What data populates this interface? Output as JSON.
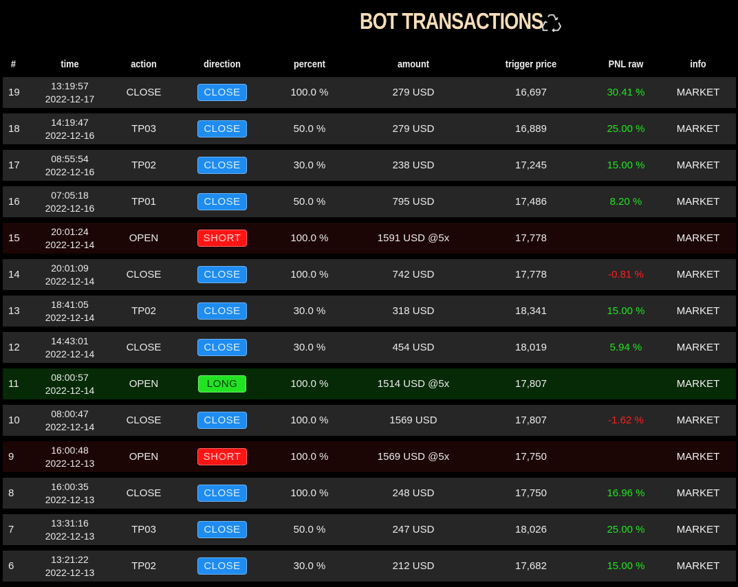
{
  "header": {
    "title": "BOT TRANSACTIONS",
    "refresh_icon": "recycle-icon"
  },
  "columns": [
    "#",
    "time",
    "action",
    "direction",
    "percent",
    "amount",
    "trigger price",
    "PNL raw",
    "info"
  ],
  "colors": {
    "close_badge": "#1e8cf0",
    "short_badge": "#ff1414",
    "long_badge": "#22e322",
    "pnl_positive": "#1ee61e",
    "pnl_negative": "#ff1f1f",
    "title": "#f5ddb8"
  },
  "rows": [
    {
      "num": "19",
      "time": "13:19:57",
      "date": "2022-12-17",
      "action": "CLOSE",
      "direction": "CLOSE",
      "percent": "100.0 %",
      "amount": "279 USD",
      "trigger": "16,697",
      "pnl": "30.41 %",
      "info": "MARKET"
    },
    {
      "num": "18",
      "time": "14:19:47",
      "date": "2022-12-16",
      "action": "TP03",
      "direction": "CLOSE",
      "percent": "50.0 %",
      "amount": "279 USD",
      "trigger": "16,889",
      "pnl": "25.00 %",
      "info": "MARKET"
    },
    {
      "num": "17",
      "time": "08:55:54",
      "date": "2022-12-16",
      "action": "TP02",
      "direction": "CLOSE",
      "percent": "30.0 %",
      "amount": "238 USD",
      "trigger": "17,245",
      "pnl": "15.00 %",
      "info": "MARKET"
    },
    {
      "num": "16",
      "time": "07:05:18",
      "date": "2022-12-16",
      "action": "TP01",
      "direction": "CLOSE",
      "percent": "50.0 %",
      "amount": "795 USD",
      "trigger": "17,486",
      "pnl": "8.20 %",
      "info": "MARKET"
    },
    {
      "num": "15",
      "time": "20:01:24",
      "date": "2022-12-14",
      "action": "OPEN",
      "direction": "SHORT",
      "percent": "100.0 %",
      "amount": "1591 USD @5x",
      "trigger": "17,778",
      "pnl": "",
      "info": "MARKET"
    },
    {
      "num": "14",
      "time": "20:01:09",
      "date": "2022-12-14",
      "action": "CLOSE",
      "direction": "CLOSE",
      "percent": "100.0 %",
      "amount": "742 USD",
      "trigger": "17,778",
      "pnl": "-0.81 %",
      "info": "MARKET"
    },
    {
      "num": "13",
      "time": "18:41:05",
      "date": "2022-12-14",
      "action": "TP02",
      "direction": "CLOSE",
      "percent": "30.0 %",
      "amount": "318 USD",
      "trigger": "18,341",
      "pnl": "15.00 %",
      "info": "MARKET"
    },
    {
      "num": "12",
      "time": "14:43:01",
      "date": "2022-12-14",
      "action": "CLOSE",
      "direction": "CLOSE",
      "percent": "30.0 %",
      "amount": "454 USD",
      "trigger": "18,019",
      "pnl": "5.94 %",
      "info": "MARKET"
    },
    {
      "num": "11",
      "time": "08:00:57",
      "date": "2022-12-14",
      "action": "OPEN",
      "direction": "LONG",
      "percent": "100.0 %",
      "amount": "1514 USD @5x",
      "trigger": "17,807",
      "pnl": "",
      "info": "MARKET"
    },
    {
      "num": "10",
      "time": "08:00:47",
      "date": "2022-12-14",
      "action": "CLOSE",
      "direction": "CLOSE",
      "percent": "100.0 %",
      "amount": "1569 USD",
      "trigger": "17,807",
      "pnl": "-1.62 %",
      "info": "MARKET"
    },
    {
      "num": "9",
      "time": "16:00:48",
      "date": "2022-12-13",
      "action": "OPEN",
      "direction": "SHORT",
      "percent": "100.0 %",
      "amount": "1569 USD @5x",
      "trigger": "17,750",
      "pnl": "",
      "info": "MARKET"
    },
    {
      "num": "8",
      "time": "16:00:35",
      "date": "2022-12-13",
      "action": "CLOSE",
      "direction": "CLOSE",
      "percent": "100.0 %",
      "amount": "248 USD",
      "trigger": "17,750",
      "pnl": "16.96 %",
      "info": "MARKET"
    },
    {
      "num": "7",
      "time": "13:31:16",
      "date": "2022-12-13",
      "action": "TP03",
      "direction": "CLOSE",
      "percent": "50.0 %",
      "amount": "247 USD",
      "trigger": "18,026",
      "pnl": "25.00 %",
      "info": "MARKET"
    },
    {
      "num": "6",
      "time": "13:21:22",
      "date": "2022-12-13",
      "action": "TP02",
      "direction": "CLOSE",
      "percent": "30.0 %",
      "amount": "212 USD",
      "trigger": "17,682",
      "pnl": "15.00 %",
      "info": "MARKET"
    }
  ]
}
